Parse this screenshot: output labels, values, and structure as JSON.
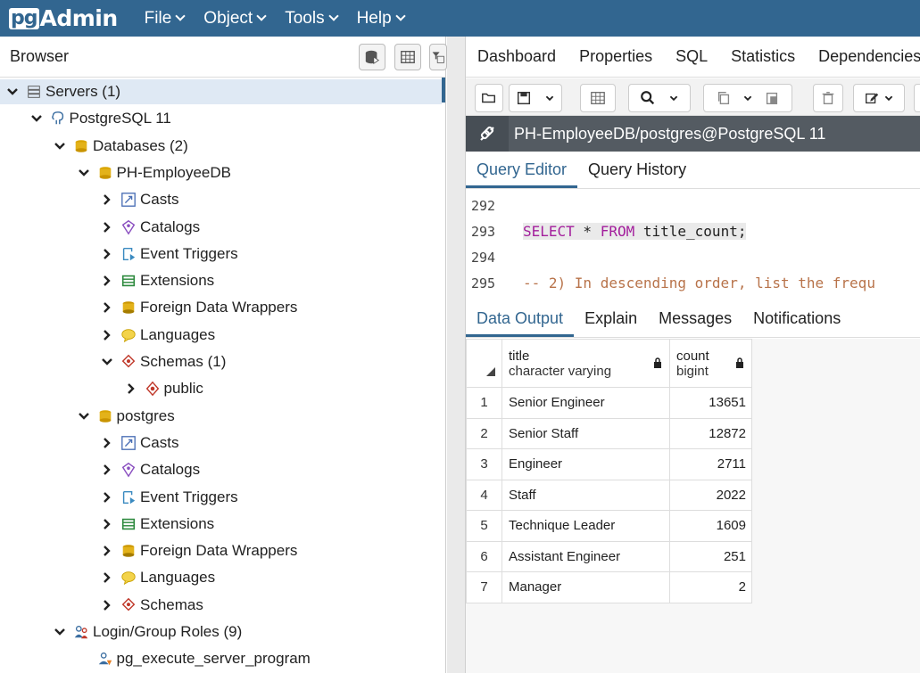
{
  "navbar": {
    "logo_pg": "pg",
    "logo_admin": "Admin",
    "menus": [
      "File",
      "Object",
      "Tools",
      "Help"
    ]
  },
  "browser": {
    "title": "Browser",
    "tree": [
      {
        "label": "Servers (1)",
        "expanded": true,
        "icon": "servers-icon"
      },
      {
        "label": "PostgreSQL 11",
        "expanded": true,
        "icon": "elephant-icon"
      },
      {
        "label": "Databases (2)",
        "expanded": true,
        "icon": "databases-icon"
      },
      {
        "label": "PH-EmployeeDB",
        "expanded": true,
        "icon": "database-icon"
      },
      {
        "label": "Casts",
        "expanded": false,
        "icon": "casts-icon"
      },
      {
        "label": "Catalogs",
        "expanded": false,
        "icon": "catalogs-icon"
      },
      {
        "label": "Event Triggers",
        "expanded": false,
        "icon": "event-triggers-icon"
      },
      {
        "label": "Extensions",
        "expanded": false,
        "icon": "extensions-icon"
      },
      {
        "label": "Foreign Data Wrappers",
        "expanded": false,
        "icon": "fdw-icon"
      },
      {
        "label": "Languages",
        "expanded": false,
        "icon": "languages-icon"
      },
      {
        "label": "Schemas (1)",
        "expanded": true,
        "icon": "schemas-icon"
      },
      {
        "label": "public",
        "expanded": false,
        "icon": "schema-icon"
      },
      {
        "label": "postgres",
        "expanded": true,
        "icon": "database-icon"
      },
      {
        "label": "Casts",
        "expanded": false,
        "icon": "casts-icon"
      },
      {
        "label": "Catalogs",
        "expanded": false,
        "icon": "catalogs-icon"
      },
      {
        "label": "Event Triggers",
        "expanded": false,
        "icon": "event-triggers-icon"
      },
      {
        "label": "Extensions",
        "expanded": false,
        "icon": "extensions-icon"
      },
      {
        "label": "Foreign Data Wrappers",
        "expanded": false,
        "icon": "fdw-icon"
      },
      {
        "label": "Languages",
        "expanded": false,
        "icon": "languages-icon"
      },
      {
        "label": "Schemas",
        "expanded": false,
        "icon": "schemas-icon"
      },
      {
        "label": "Login/Group Roles (9)",
        "expanded": true,
        "icon": "roles-icon"
      },
      {
        "label": "pg_execute_server_program",
        "expanded": false,
        "icon": "role-icon"
      }
    ]
  },
  "right_tabs": [
    "Dashboard",
    "Properties",
    "SQL",
    "Statistics",
    "Dependencies"
  ],
  "connection": {
    "label": "PH-EmployeeDB/postgres@PostgreSQL 11"
  },
  "editor_tabs": {
    "query_editor": "Query Editor",
    "query_history": "Query History"
  },
  "code": {
    "lines": [
      {
        "num": "292",
        "text": ""
      },
      {
        "num": "293",
        "kw1": "SELECT",
        "mid": " * ",
        "kw2": "FROM",
        "rest": " title_count;"
      },
      {
        "num": "294",
        "text": ""
      },
      {
        "num": "295",
        "comment": "-- 2) In descending order, list the frequ"
      }
    ]
  },
  "output_tabs": {
    "data_output": "Data Output",
    "explain": "Explain",
    "messages": "Messages",
    "notifications": "Notifications"
  },
  "grid": {
    "columns": [
      {
        "name": "title",
        "type": "character varying"
      },
      {
        "name": "count",
        "type": "bigint"
      }
    ],
    "rows": [
      {
        "n": "1",
        "title": "Senior Engineer",
        "count": "13651"
      },
      {
        "n": "2",
        "title": "Senior Staff",
        "count": "12872"
      },
      {
        "n": "3",
        "title": "Engineer",
        "count": "2711"
      },
      {
        "n": "4",
        "title": "Staff",
        "count": "2022"
      },
      {
        "n": "5",
        "title": "Technique Leader",
        "count": "1609"
      },
      {
        "n": "6",
        "title": "Assistant Engineer",
        "count": "251"
      },
      {
        "n": "7",
        "title": "Manager",
        "count": "2"
      }
    ]
  },
  "colors": {
    "navbar": "#326690",
    "selection": "#dfe9f4",
    "conn_bar": "#545b62"
  }
}
